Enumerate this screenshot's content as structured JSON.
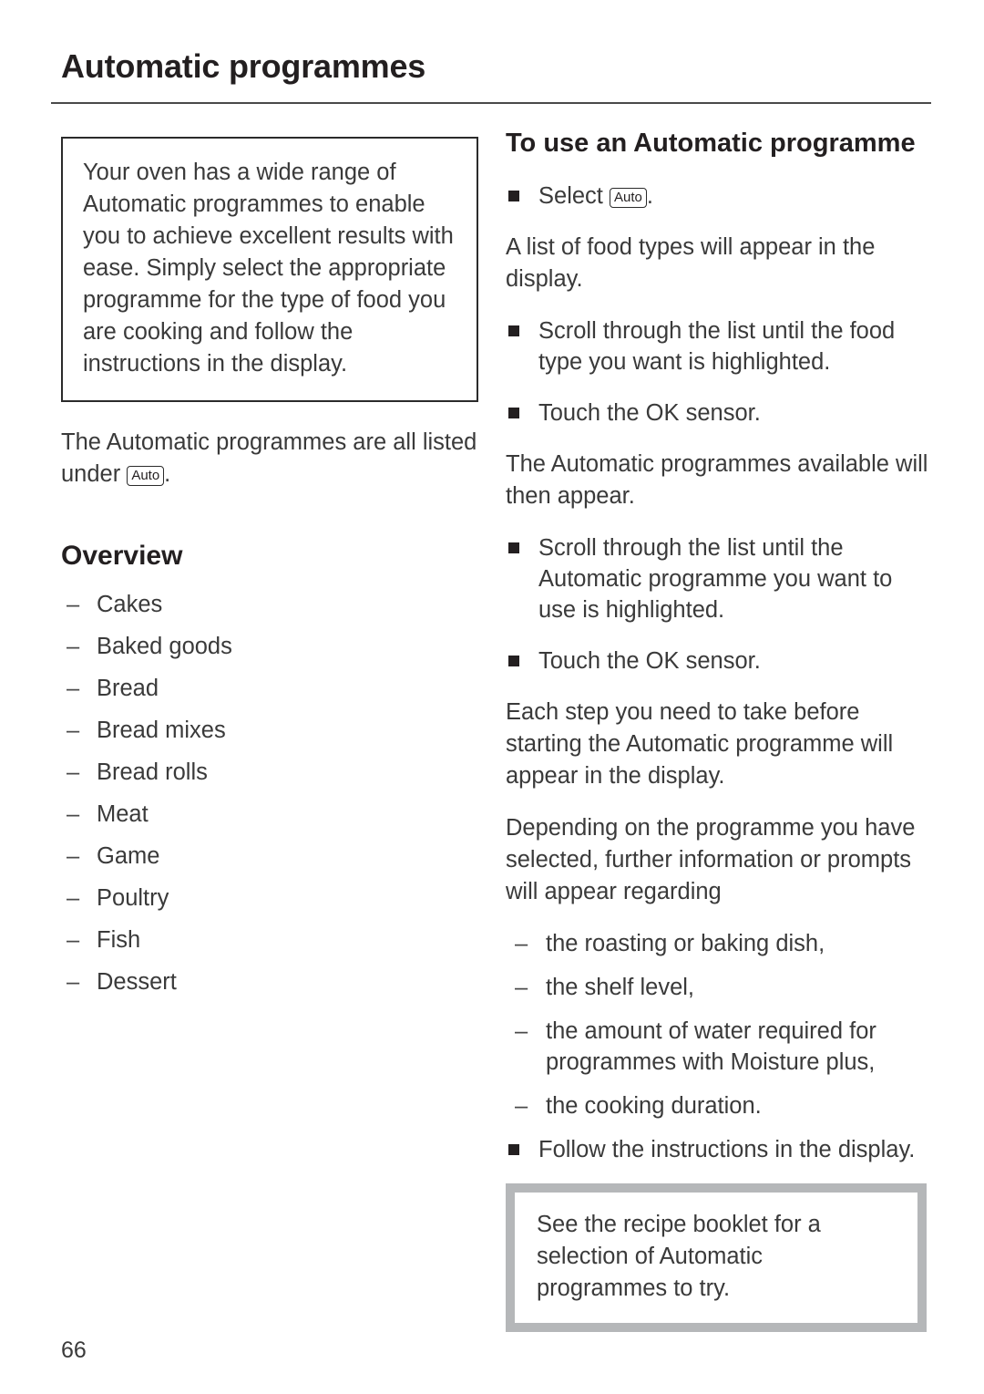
{
  "header": {
    "title": "Automatic programmes"
  },
  "left_column": {
    "intro_box": {
      "text": "Your oven has a wide range of Automatic programmes to enable you to achieve excellent results with ease. Simply select the appropriate programme for the type of food you are cooking and follow the instructions in the display."
    },
    "after_box": {
      "text_before_key": "The Automatic programmes are all listed under ",
      "key_label": "Auto",
      "text_after_key": "."
    },
    "overview": {
      "heading": "Overview",
      "items": [
        "Cakes",
        "Baked goods",
        "Bread",
        "Bread mixes",
        "Bread rolls",
        "Meat",
        "Game",
        "Poultry",
        "Fish",
        "Dessert"
      ]
    }
  },
  "right_column": {
    "heading": "To use an Automatic programme",
    "step_select": {
      "text_before_key": "Select ",
      "key_label": "Auto",
      "text_after_key": "."
    },
    "para_food_types": "A list of food types will appear in the display.",
    "step_scroll_food": "Scroll through the list until the food type you want is highlighted.",
    "step_touch_ok_1": "Touch the OK sensor.",
    "para_programmes_appear": "The Automatic programmes available will then appear.",
    "step_scroll_programme": "Scroll through the list until the Automatic programme you want to use is highlighted.",
    "step_touch_ok_2": "Touch the OK sensor.",
    "para_each_step": "Each step you need to take before starting the Automatic programme will appear in the display.",
    "para_depending": "Depending on the programme you have selected, further information or prompts will appear regarding",
    "prompt_items": [
      "the roasting or baking dish,",
      "the shelf level,",
      "the amount of water required for programmes with Moisture plus,",
      "the cooking duration."
    ],
    "step_follow": "Follow the instructions in the display.",
    "tip_box": {
      "text": "See the recipe booklet for a selection of Automatic programmes to try."
    }
  },
  "footer": {
    "page_number": "66"
  },
  "colors": {
    "text": "#3a3a3a",
    "heading": "#231f20",
    "rule": "#4a4a4a",
    "tip_border": "#b5b7b9",
    "note_border": "#2b2b2b"
  }
}
